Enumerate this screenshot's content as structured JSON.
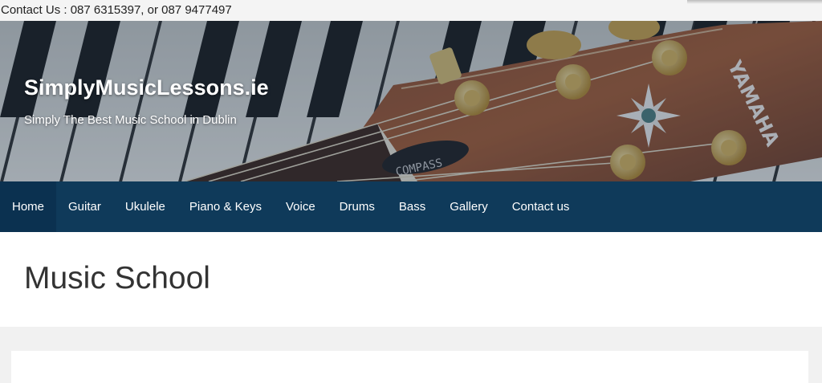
{
  "contact": {
    "text": "Contact Us : 087 6315397, or 087 9477497"
  },
  "site": {
    "title": "SimplyMusicLessons.ie",
    "tagline": "Simply The Best Music School in Dublin",
    "header_image": "piano-keys-and-guitar-headstock",
    "guitar_brand": "YAMAHA",
    "guitar_model": "COMPASS"
  },
  "nav": {
    "items": [
      {
        "label": "Home",
        "active": true
      },
      {
        "label": "Guitar",
        "active": false
      },
      {
        "label": "Ukulele",
        "active": false
      },
      {
        "label": "Piano & Keys",
        "active": false
      },
      {
        "label": "Voice",
        "active": false
      },
      {
        "label": "Drums",
        "active": false
      },
      {
        "label": "Bass",
        "active": false
      },
      {
        "label": "Gallery",
        "active": false
      },
      {
        "label": "Contact us",
        "active": false
      }
    ]
  },
  "page": {
    "title": "Music School"
  },
  "colors": {
    "nav_background": "#0f3a5a",
    "nav_active": "#0b3150",
    "page_background": "#f1f1f1",
    "title_band": "#ffffff"
  }
}
